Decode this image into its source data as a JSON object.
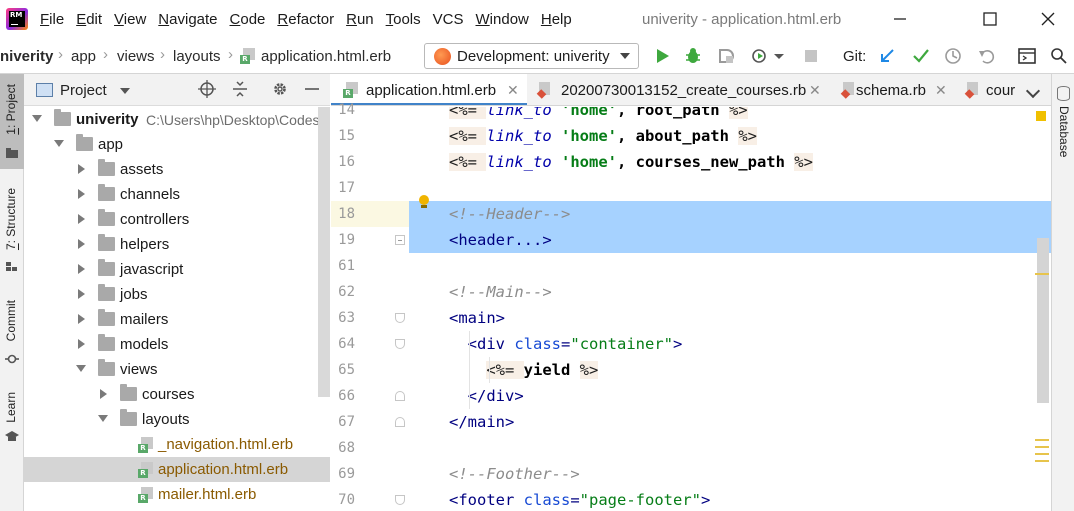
{
  "window": {
    "title": "univerity - application.html.erb",
    "logo_text": "RM"
  },
  "menu": {
    "items": [
      {
        "label": "File",
        "mnemonic": "F",
        "rest": "ile"
      },
      {
        "label": "Edit",
        "mnemonic": "E",
        "rest": "dit"
      },
      {
        "label": "View",
        "mnemonic": "V",
        "rest": "iew"
      },
      {
        "label": "Navigate",
        "mnemonic": "N",
        "rest": "avigate"
      },
      {
        "label": "Code",
        "mnemonic": "C",
        "rest": "ode"
      },
      {
        "label": "Refactor",
        "mnemonic": "R",
        "rest": "efactor"
      },
      {
        "label": "Run",
        "mnemonic": "R",
        "rest": "un"
      },
      {
        "label": "Tools",
        "mnemonic": "T",
        "rest": "ools"
      },
      {
        "label": "VCS",
        "mnemonic": "",
        "rest": "VCS"
      },
      {
        "label": "Window",
        "mnemonic": "W",
        "rest": "indow"
      },
      {
        "label": "Help",
        "mnemonic": "H",
        "rest": "elp"
      }
    ]
  },
  "breadcrumb": {
    "project": "niverity",
    "items": [
      "app",
      "views",
      "layouts"
    ],
    "file": "application.html.erb"
  },
  "run_config": {
    "label": "Development: univerity"
  },
  "git": {
    "label": "Git:"
  },
  "left_strip": {
    "project_tab": {
      "mnemonic": "1",
      "rest": ": Project"
    },
    "structure_tab": {
      "mnemonic": "7",
      "rest": ": Structure"
    },
    "commit_tab": "Commit",
    "learn_tab": "Learn"
  },
  "right_strip": {
    "database_tab": "Database"
  },
  "project_panel": {
    "title": "Project",
    "tree": [
      {
        "label": "univerity",
        "path": "C:\\Users\\hp\\Desktop\\Codes\\",
        "kind": "root"
      },
      {
        "label": "app",
        "kind": "folder-open"
      },
      {
        "label": "assets",
        "kind": "folder"
      },
      {
        "label": "channels",
        "kind": "folder"
      },
      {
        "label": "controllers",
        "kind": "folder"
      },
      {
        "label": "helpers",
        "kind": "folder"
      },
      {
        "label": "javascript",
        "kind": "folder"
      },
      {
        "label": "jobs",
        "kind": "folder"
      },
      {
        "label": "mailers",
        "kind": "folder"
      },
      {
        "label": "models",
        "kind": "folder"
      },
      {
        "label": "views",
        "kind": "folder-open"
      },
      {
        "label": "courses",
        "kind": "folder"
      },
      {
        "label": "layouts",
        "kind": "folder-open"
      },
      {
        "label": "_navigation.html.erb",
        "kind": "erb"
      },
      {
        "label": "application.html.erb",
        "kind": "erb",
        "selected": true
      },
      {
        "label": "mailer.html.erb",
        "kind": "erb"
      }
    ]
  },
  "tabs": [
    {
      "label": "application.html.erb",
      "active": true
    },
    {
      "label": "20200730013152_create_courses.rb"
    },
    {
      "label": "schema.rb"
    },
    {
      "label": "cour"
    }
  ],
  "editor": {
    "line_numbers": [
      "14",
      "15",
      "16",
      "17",
      "18",
      "19",
      "61",
      "62",
      "63",
      "64",
      "65",
      "66",
      "67",
      "68",
      "69",
      "70"
    ],
    "lines": [
      {
        "tokens": [
          [
            "erb",
            "<%= "
          ],
          [
            "mth",
            "link_to"
          ],
          [
            "str",
            " 'home'"
          ],
          [
            "id",
            ", root_path "
          ],
          [
            "erb",
            "%>"
          ]
        ]
      },
      {
        "tokens": [
          [
            "erb",
            "<%= "
          ],
          [
            "mth",
            "link_to"
          ],
          [
            "str",
            " 'home'"
          ],
          [
            "id",
            ", about_path "
          ],
          [
            "erb",
            "%>"
          ]
        ]
      },
      {
        "tokens": [
          [
            "erb",
            "<%= "
          ],
          [
            "mth",
            "link_to"
          ],
          [
            "str",
            " 'home'"
          ],
          [
            "id",
            ", courses_new_path "
          ],
          [
            "erb",
            "%>"
          ]
        ]
      },
      {
        "tokens": []
      },
      {
        "tokens": [
          [
            "cmt",
            "<!--Header-->"
          ]
        ],
        "selected": true
      },
      {
        "tokens": [
          [
            "tag",
            "<header...>"
          ]
        ],
        "selected": true
      },
      {
        "tokens": []
      },
      {
        "tokens": [
          [
            "cmt",
            "<!--Main-->"
          ]
        ]
      },
      {
        "tokens": [
          [
            "tag",
            "<main>"
          ]
        ]
      },
      {
        "tokens": [
          [
            "plain",
            "  "
          ],
          [
            "tag",
            "<div "
          ],
          [
            "attr",
            "class"
          ],
          [
            "tag",
            "="
          ],
          [
            "aval",
            "\"container\""
          ],
          [
            "tag",
            ">"
          ]
        ]
      },
      {
        "tokens": [
          [
            "plain",
            "    "
          ],
          [
            "erb",
            "<%= "
          ],
          [
            "id",
            "yield "
          ],
          [
            "erb",
            "%>"
          ]
        ]
      },
      {
        "tokens": [
          [
            "plain",
            "  "
          ],
          [
            "tag",
            "</div>"
          ]
        ]
      },
      {
        "tokens": [
          [
            "tag",
            "</main>"
          ]
        ]
      },
      {
        "tokens": []
      },
      {
        "tokens": [
          [
            "cmt",
            "<!--Foother-->"
          ]
        ]
      },
      {
        "tokens": [
          [
            "tag",
            "<footer "
          ],
          [
            "attr",
            "class"
          ],
          [
            "tag",
            "="
          ],
          [
            "aval",
            "\"page-footer\""
          ],
          [
            "tag",
            ">"
          ]
        ]
      }
    ]
  },
  "colors": {
    "accent_tab": "#4083c9",
    "selection": "#a6d2ff",
    "run_green": "#3ea83e",
    "vcs_blue": "#1e88e5",
    "warning": "#f0c000"
  }
}
